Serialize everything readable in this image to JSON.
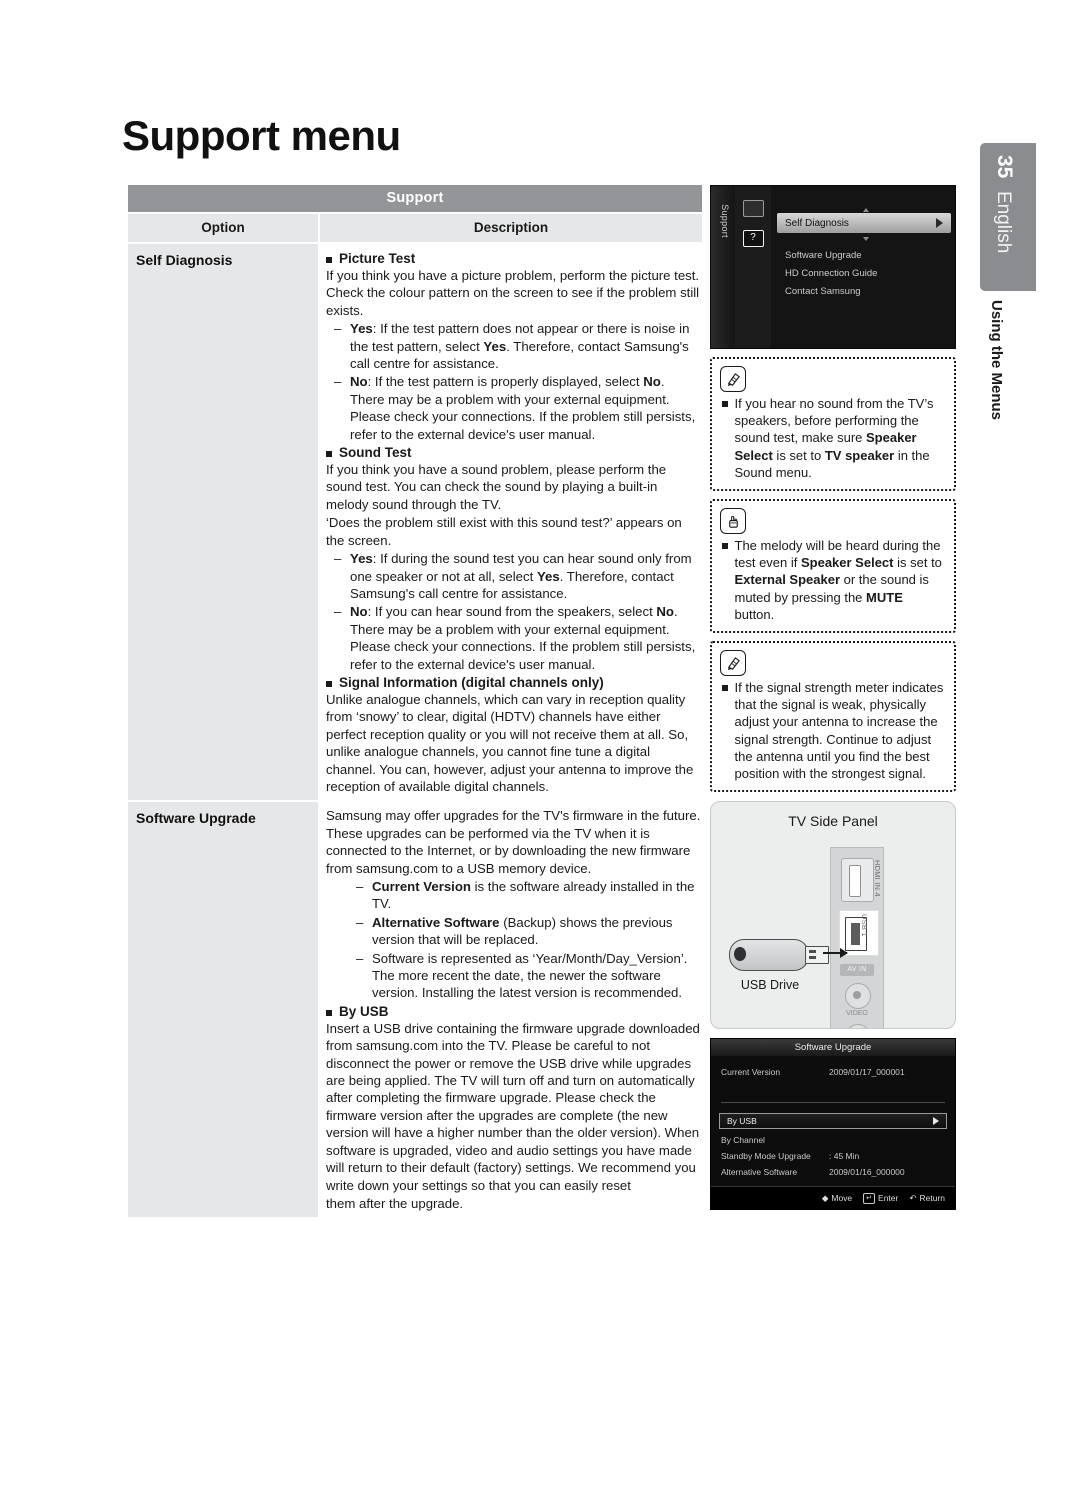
{
  "page": {
    "title": "Support menu",
    "number": "35",
    "language": "English",
    "chapter": "Using the Menus"
  },
  "table": {
    "caption": "Support",
    "headers": [
      "Option",
      "Description"
    ],
    "rows": [
      {
        "option": "Self Diagnosis",
        "blocks": [
          {
            "type": "bullet",
            "text": "Picture Test"
          },
          {
            "type": "para",
            "text": "If you think you have a picture problem, perform the picture test. Check the colour pattern on the screen to see if the problem still exists."
          },
          {
            "type": "dash",
            "html": "<b>Yes</b>: If the test pattern does not appear or there is noise in the test pattern, select <b>Yes</b>. Therefore, contact Samsung's call centre for assistance."
          },
          {
            "type": "dash",
            "html": "<b>No</b>: If the test pattern is properly displayed, select <b>No</b>. There may be a problem with your external equipment. Please check your connections. If the problem still persists, refer to the external device's user manual."
          },
          {
            "type": "bullet",
            "text": "Sound Test"
          },
          {
            "type": "para",
            "text": "If you think you have a sound problem, please perform the sound test. You can check the sound by playing a built-in melody sound through the TV."
          },
          {
            "type": "para",
            "text": "‘Does the problem still exist with this sound test?’ appears on the screen."
          },
          {
            "type": "dash",
            "html": "<b>Yes</b>: If during the sound test you can hear sound only from one speaker or not at all, select <b>Yes</b>. Therefore, contact Samsung's call centre for assistance."
          },
          {
            "type": "dash",
            "html": "<b>No</b>: If you can hear sound from the speakers, select <b>No</b>. There may be a problem with your external equipment. Please check your connections. If the problem still persists, refer to the external device's user manual."
          },
          {
            "type": "bullet",
            "text": "Signal Information (digital channels only)"
          },
          {
            "type": "para",
            "text": "Unlike analogue channels, which can vary in reception quality from ‘snowy’ to clear, digital (HDTV) channels have either perfect reception quality or you will not receive them at all. So, unlike analogue channels, you cannot fine tune a digital channel. You can, however, adjust your antenna to improve the reception of available digital channels."
          }
        ]
      },
      {
        "option": "Software Upgrade",
        "blocks": [
          {
            "type": "para",
            "text": "Samsung may offer upgrades for the TV's firmware in the future. These upgrades can be performed via the TV when it is connected to the Internet, or by downloading the new firmware from samsung.com to a USB memory device."
          },
          {
            "type": "dash2",
            "html": "<b>Current Version</b> is the software already installed in the TV."
          },
          {
            "type": "dash2",
            "html": "<b>Alternative Software</b> (Backup) shows the previous version that will be replaced."
          },
          {
            "type": "dash2",
            "html": "Software is represented as ‘Year/Month/Day_Version’. The more recent the date, the newer the software version. Installing the latest version is recommended."
          },
          {
            "type": "bullet",
            "text": "By USB"
          },
          {
            "type": "para",
            "text": "Insert a USB drive containing the firmware upgrade downloaded from samsung.com into the TV. Please be careful to not disconnect the power or remove the USB drive while upgrades are being applied. The TV will turn off and turn on automatically after completing the firmware upgrade. Please check the firmware version after the upgrades are complete (the new version will have a higher number than the older version). When software is upgraded, video and audio settings you have made will return to their default (factory) settings. We recommend you write down your settings so that you can easily reset"
          },
          {
            "type": "para",
            "text": "them after the upgrade."
          }
        ]
      }
    ]
  },
  "osd_support": {
    "sidebar_label": "Support",
    "selected_item": "Self Diagnosis",
    "items": [
      "Software Upgrade",
      "HD Connection Guide",
      "Contact Samsung"
    ],
    "icon_glyph": "?"
  },
  "notes": [
    {
      "icon": "note-pencil-icon",
      "html": "If you hear no sound from the TV’s speakers, before performing the sound test, make sure <b>Speaker Select</b> is set to <b>TV speaker</b> in the Sound menu."
    },
    {
      "icon": "hand-press-icon",
      "html": "The melody will be heard during the test even if <b>Speaker Select</b> is set to <b>External Speaker</b> or the sound is muted by pressing the <b>MUTE</b> button."
    },
    {
      "icon": "note-pencil-icon",
      "html": "If the signal strength meter indicates that the signal is weak, physically adjust your antenna to increase the signal strength. Continue to adjust the antenna until you find the best position with the strongest signal."
    }
  ],
  "side_panel": {
    "title": "TV Side Panel",
    "usb_drive_label": "USB Drive",
    "ports": {
      "hdmi": "HDMI IN 4",
      "usb": "USB 1",
      "av_in": "AV IN",
      "video": "VIDEO"
    }
  },
  "osd_upgrade": {
    "title": "Software Upgrade",
    "rows": [
      {
        "label": "Current Version",
        "value": "2009/01/17_000001"
      },
      {
        "label": "By Channel",
        "value": ""
      },
      {
        "label": "Standby Mode Upgrade",
        "value": ": 45 Min"
      },
      {
        "label": "Alternative Software",
        "value": "2009/01/16_000000"
      }
    ],
    "selected_row": "By USB",
    "footer": {
      "move": "Move",
      "enter": "Enter",
      "return": "Return"
    }
  },
  "colors": {
    "table_caption_bg": "#949599",
    "table_header_bg": "#e6e7e8",
    "badge_bg": "#8a8c8f"
  }
}
